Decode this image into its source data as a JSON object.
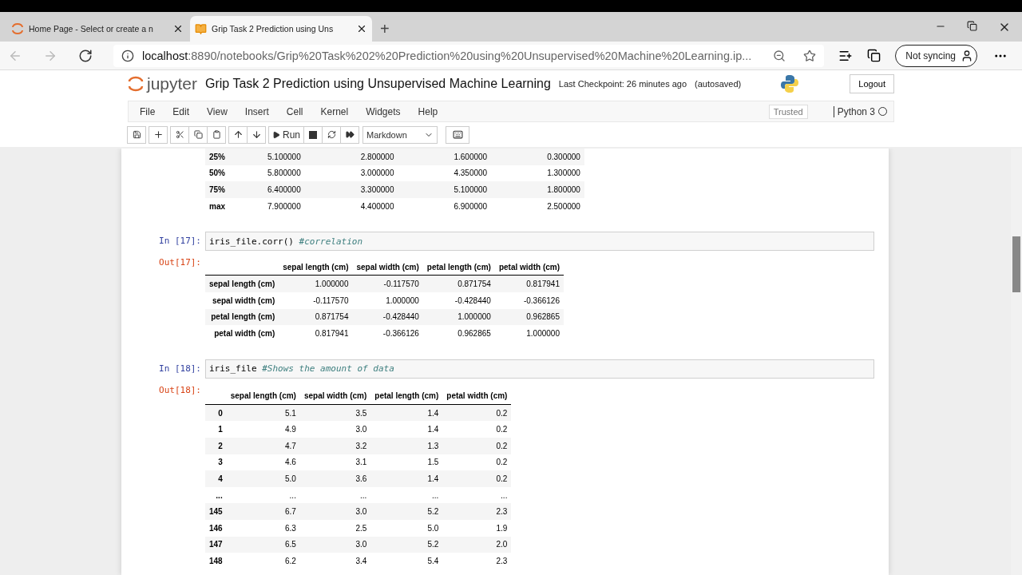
{
  "browser": {
    "tabs": [
      {
        "title": "Home Page - Select or create a n",
        "selected": false
      },
      {
        "title": "Grip Task 2 Prediction using Uns",
        "selected": true
      }
    ],
    "new_tab": "+",
    "address_host": "localhost",
    "address_rest": ":8890/notebooks/Grip%20Task%202%20Prediction%20using%20Unsupervised%20Machine%20Learning.ip...",
    "sync_button": "Not syncing"
  },
  "jupyter": {
    "logo": "jupyter",
    "title": "Grip Task 2 Prediction using Unsupervised Machine Learning",
    "checkpoint": "Last Checkpoint: 26 minutes ago",
    "autosave": "(autosaved)",
    "logout": "Logout",
    "menu": [
      "File",
      "Edit",
      "View",
      "Insert",
      "Cell",
      "Kernel",
      "Widgets",
      "Help"
    ],
    "trusted": "Trusted",
    "kernel": "Python 3",
    "run": "Run",
    "cell_type": "Markdown"
  },
  "cells": [
    {
      "kind": "output",
      "rows": [
        [
          "25%",
          "5.100000",
          "2.800000",
          "1.600000",
          "0.300000"
        ],
        [
          "50%",
          "5.800000",
          "3.000000",
          "4.350000",
          "1.300000"
        ],
        [
          "75%",
          "6.400000",
          "3.300000",
          "5.100000",
          "1.800000"
        ],
        [
          "max",
          "7.900000",
          "4.400000",
          "6.900000",
          "2.500000"
        ]
      ]
    },
    {
      "kind": "input",
      "prompt": "In [17]:",
      "code": "iris_file.corr()",
      "comment": "#correlation"
    },
    {
      "kind": "output",
      "prompt": "Out[17]:",
      "columns": [
        "",
        "sepal length (cm)",
        "sepal width (cm)",
        "petal length (cm)",
        "petal width (cm)"
      ],
      "rows": [
        [
          "sepal length (cm)",
          "1.000000",
          "-0.117570",
          "0.871754",
          "0.817941"
        ],
        [
          "sepal width (cm)",
          "-0.117570",
          "1.000000",
          "-0.428440",
          "-0.366126"
        ],
        [
          "petal length (cm)",
          "0.871754",
          "-0.428440",
          "1.000000",
          "0.962865"
        ],
        [
          "petal width (cm)",
          "0.817941",
          "-0.366126",
          "0.962865",
          "1.000000"
        ]
      ]
    },
    {
      "kind": "input",
      "prompt": "In [18]:",
      "code": "iris_file",
      "comment": "#Shows the amount of data"
    },
    {
      "kind": "output",
      "prompt": "Out[18]:",
      "columns": [
        "",
        "sepal length (cm)",
        "sepal width (cm)",
        "petal length (cm)",
        "petal width (cm)"
      ],
      "rows": [
        [
          "0",
          "5.1",
          "3.5",
          "1.4",
          "0.2"
        ],
        [
          "1",
          "4.9",
          "3.0",
          "1.4",
          "0.2"
        ],
        [
          "2",
          "4.7",
          "3.2",
          "1.3",
          "0.2"
        ],
        [
          "3",
          "4.6",
          "3.1",
          "1.5",
          "0.2"
        ],
        [
          "4",
          "5.0",
          "3.6",
          "1.4",
          "0.2"
        ],
        [
          "...",
          "...",
          "...",
          "...",
          "..."
        ],
        [
          "145",
          "6.7",
          "3.0",
          "5.2",
          "2.3"
        ],
        [
          "146",
          "6.3",
          "2.5",
          "5.0",
          "1.9"
        ],
        [
          "147",
          "6.5",
          "3.0",
          "5.2",
          "2.0"
        ],
        [
          "148",
          "6.2",
          "3.4",
          "5.4",
          "2.3"
        ]
      ]
    }
  ]
}
